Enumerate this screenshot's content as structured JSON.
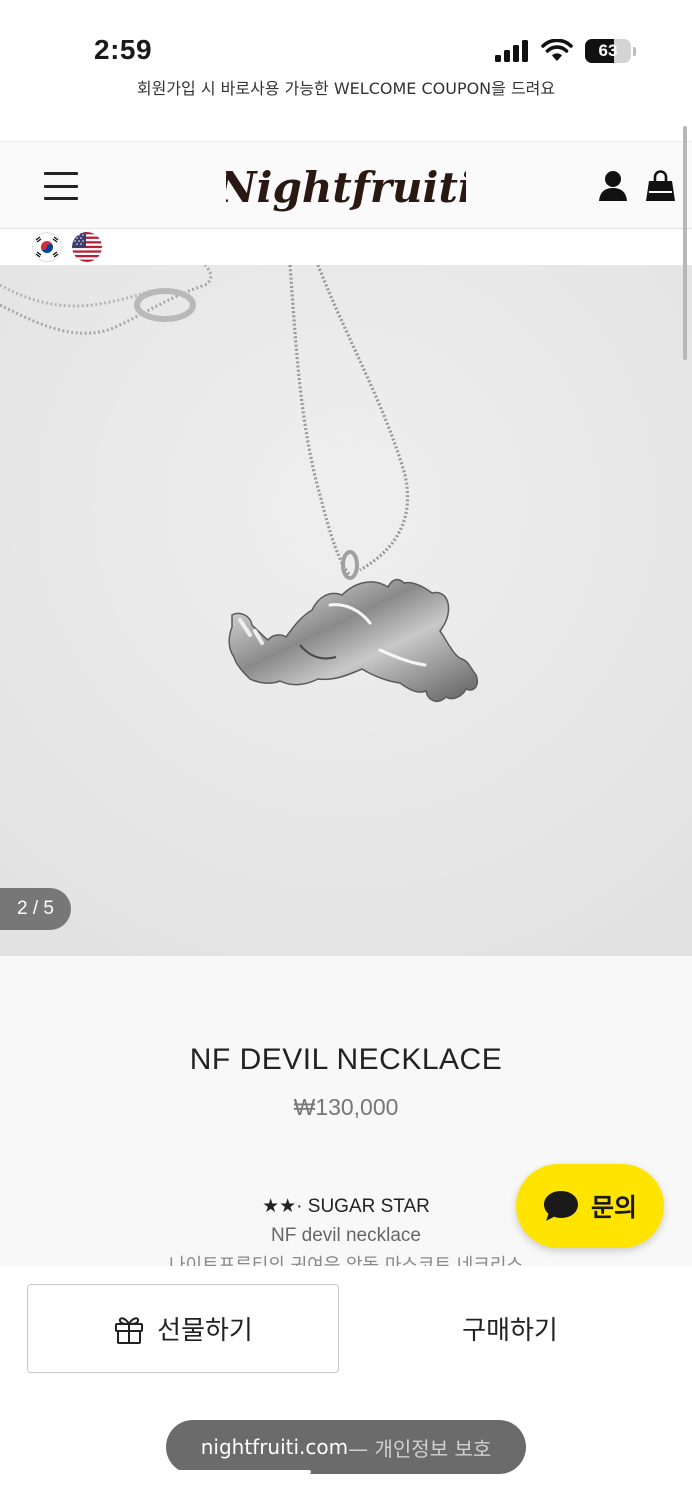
{
  "status_bar": {
    "time": "2:59",
    "battery": "63",
    "battery_level": 0.63
  },
  "banner": {
    "text": "회원가입 시 바로사용 가능한 WELCOME COUPON을 드려요"
  },
  "header": {
    "logo_text": "Nightfruiti",
    "menu_icon": "hamburger-menu-icon",
    "user_icon": "user-icon",
    "cart_icon": "shopping-bag-icon"
  },
  "languages": [
    {
      "name": "korean-flag"
    },
    {
      "name": "us-flag"
    }
  ],
  "gallery": {
    "counter": "2 / 5"
  },
  "product": {
    "name": "NF DEVIL NECKLACE",
    "price": "₩130,000",
    "desc_line1": "★★· SUGAR STAR",
    "desc_line2": "NF devil necklace",
    "desc_line3": "나이트프루티의 귀여운 악동 마스코트 네크리스"
  },
  "inquiry": {
    "label": "문의"
  },
  "actions": {
    "gift_label": "선물하기",
    "buy_label": "구매하기"
  },
  "browser": {
    "domain": "nightfruiti.com",
    "separator": " — 개인정보 보호"
  },
  "colors": {
    "kakao_yellow": "#ffe400",
    "page_bg": "#f8f8f8",
    "image_bg": "#eaeaea"
  }
}
